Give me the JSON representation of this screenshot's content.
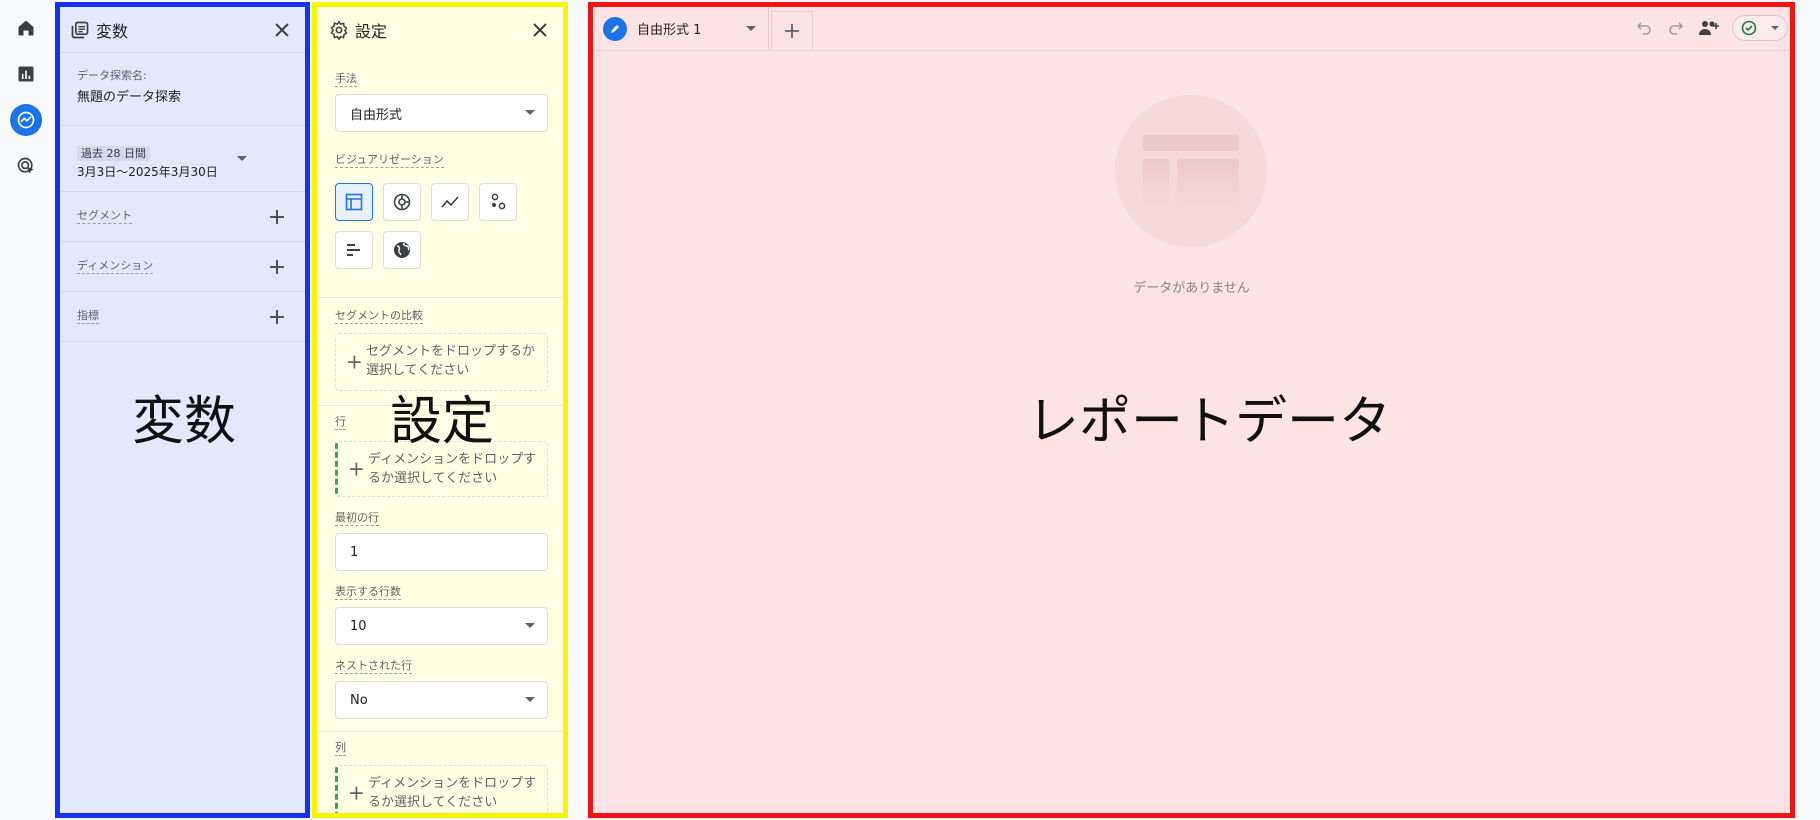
{
  "variables_panel": {
    "title": "変数",
    "exploration_label": "データ探索名:",
    "exploration_name": "無題のデータ探索",
    "date_badge": "過去 28 日間",
    "date_range": "3月3日～2025年3月30日",
    "segments_label": "セグメント",
    "dimensions_label": "ディメンション",
    "metrics_label": "指標",
    "overlay_label": "変数"
  },
  "settings_panel": {
    "title": "設定",
    "technique_label": "手法",
    "technique_value": "自由形式",
    "visualization_label": "ビジュアリゼーション",
    "segment_compare_label": "セグメントの比較",
    "segment_drop_text": "セグメントをドロップするか選択してください",
    "rows_label": "行",
    "rows_drop_text": "ディメンションをドロップするか選択してください",
    "first_row_label": "最初の行",
    "first_row_value": "1",
    "show_rows_label": "表示する行数",
    "show_rows_value": "10",
    "nested_rows_label": "ネストされた行",
    "nested_rows_value": "No",
    "columns_label": "列",
    "columns_drop_text": "ディメンションをドロップするか選択してください",
    "overlay_label": "設定"
  },
  "report_panel": {
    "tab_label": "自由形式 1",
    "empty_text": "データがありません",
    "overlay_label": "レポートデータ"
  },
  "colors": {
    "variables_border": "#1433f0",
    "settings_border": "#f6f600",
    "report_border": "#f41414",
    "accent": "#1a73e8"
  }
}
